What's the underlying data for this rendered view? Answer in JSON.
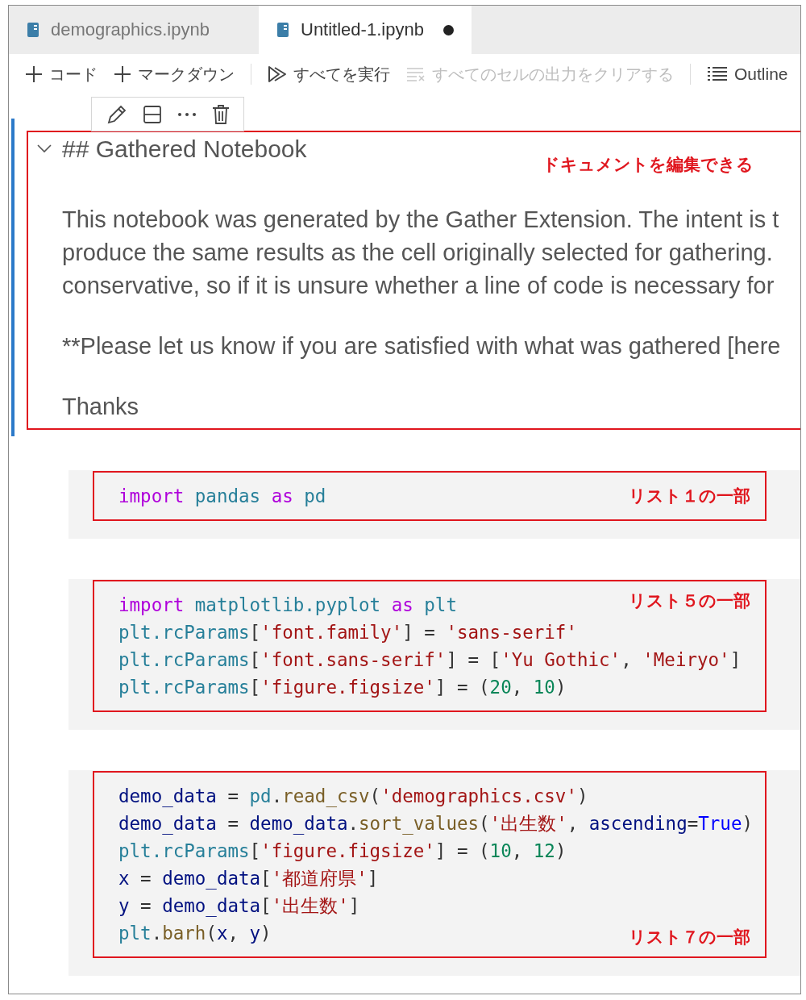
{
  "tabs": [
    {
      "label": "demographics.ipynb",
      "selected": false,
      "modified": false
    },
    {
      "label": "Untitled-1.ipynb",
      "selected": true,
      "modified": true
    }
  ],
  "toolbar": [
    {
      "kind": "add",
      "label": "コード",
      "disabled": false
    },
    {
      "kind": "add",
      "label": "マークダウン",
      "disabled": false
    },
    {
      "kind": "run",
      "label": "すべてを実行",
      "disabled": false
    },
    {
      "kind": "clear",
      "label": "すべてのセルの出力をクリアする",
      "disabled": true
    },
    {
      "kind": "outline",
      "label": "Outline",
      "disabled": false
    }
  ],
  "markdown_cell": {
    "expanded": true,
    "heading": "## Gathered Notebook",
    "annotation": "ドキュメントを編集できる",
    "paragraphs": [
      [
        "This notebook was generated by the Gather Extension. The intent is t",
        "produce the same results as the cell originally selected for gathering.",
        "conservative, so if it is unsure whether a line of code is necessary for"
      ],
      [
        "**Please let us know if you are satisfied with what was gathered [here"
      ],
      [
        "Thanks"
      ]
    ]
  },
  "code_cells": [
    {
      "annotation": "リスト１の一部",
      "lines": [
        [
          {
            "text": "import",
            "kind": "keyword"
          },
          {
            "text": " pandas ",
            "kind": "module"
          },
          {
            "text": "as",
            "kind": "keyword"
          },
          {
            "text": " pd",
            "kind": "module"
          }
        ]
      ]
    },
    {
      "annotation": "リスト５の一部",
      "lines": [
        [
          {
            "text": "import",
            "kind": "keyword"
          },
          {
            "text": " matplotlib.pyplot ",
            "kind": "module"
          },
          {
            "text": "as",
            "kind": "keyword"
          },
          {
            "text": " plt",
            "kind": "module"
          }
        ],
        [
          {
            "text": "plt.rcParams",
            "kind": "module"
          },
          {
            "text": "[",
            "kind": "operator"
          },
          {
            "text": "'font.family'",
            "kind": "string"
          },
          {
            "text": "] = ",
            "kind": "operator"
          },
          {
            "text": "'sans-serif'",
            "kind": "string"
          }
        ],
        [
          {
            "text": "plt.rcParams",
            "kind": "module"
          },
          {
            "text": "[",
            "kind": "operator"
          },
          {
            "text": "'font.sans-serif'",
            "kind": "string"
          },
          {
            "text": "] = [",
            "kind": "operator"
          },
          {
            "text": "'Yu Gothic'",
            "kind": "string"
          },
          {
            "text": ", ",
            "kind": "operator"
          },
          {
            "text": "'Meiryo'",
            "kind": "string"
          },
          {
            "text": "]",
            "kind": "operator"
          }
        ],
        [
          {
            "text": "plt.rcParams",
            "kind": "module"
          },
          {
            "text": "[",
            "kind": "operator"
          },
          {
            "text": "'figure.figsize'",
            "kind": "string"
          },
          {
            "text": "] = (",
            "kind": "operator"
          },
          {
            "text": "20",
            "kind": "number"
          },
          {
            "text": ", ",
            "kind": "operator"
          },
          {
            "text": "10",
            "kind": "number"
          },
          {
            "text": ")",
            "kind": "operator"
          }
        ]
      ]
    },
    {
      "annotation": "リスト７の一部",
      "lines": [
        [
          {
            "text": "demo_data",
            "kind": "variable"
          },
          {
            "text": " = ",
            "kind": "operator"
          },
          {
            "text": "pd",
            "kind": "module"
          },
          {
            "text": ".",
            "kind": "operator"
          },
          {
            "text": "read_csv",
            "kind": "function"
          },
          {
            "text": "(",
            "kind": "operator"
          },
          {
            "text": "'demographics.csv'",
            "kind": "string"
          },
          {
            "text": ")",
            "kind": "operator"
          }
        ],
        [
          {
            "text": "demo_data",
            "kind": "variable"
          },
          {
            "text": " = ",
            "kind": "operator"
          },
          {
            "text": "demo_data",
            "kind": "variable"
          },
          {
            "text": ".",
            "kind": "operator"
          },
          {
            "text": "sort_values",
            "kind": "function"
          },
          {
            "text": "(",
            "kind": "operator"
          },
          {
            "text": "'出生数'",
            "kind": "string"
          },
          {
            "text": ", ",
            "kind": "operator"
          },
          {
            "text": "ascending",
            "kind": "variable"
          },
          {
            "text": "=",
            "kind": "operator"
          },
          {
            "text": "True",
            "kind": "constant"
          },
          {
            "text": ")",
            "kind": "operator"
          }
        ],
        [
          {
            "text": "plt.rcParams",
            "kind": "module"
          },
          {
            "text": "[",
            "kind": "operator"
          },
          {
            "text": "'figure.figsize'",
            "kind": "string"
          },
          {
            "text": "] = (",
            "kind": "operator"
          },
          {
            "text": "10",
            "kind": "number"
          },
          {
            "text": ", ",
            "kind": "operator"
          },
          {
            "text": "12",
            "kind": "number"
          },
          {
            "text": ")",
            "kind": "operator"
          }
        ],
        [
          {
            "text": "x",
            "kind": "variable"
          },
          {
            "text": " = ",
            "kind": "operator"
          },
          {
            "text": "demo_data",
            "kind": "variable"
          },
          {
            "text": "[",
            "kind": "operator"
          },
          {
            "text": "'都道府県'",
            "kind": "string"
          },
          {
            "text": "]",
            "kind": "operator"
          }
        ],
        [
          {
            "text": "y",
            "kind": "variable"
          },
          {
            "text": " = ",
            "kind": "operator"
          },
          {
            "text": "demo_data",
            "kind": "variable"
          },
          {
            "text": "[",
            "kind": "operator"
          },
          {
            "text": "'出生数'",
            "kind": "string"
          },
          {
            "text": "]",
            "kind": "operator"
          }
        ],
        [
          {
            "text": "plt",
            "kind": "module"
          },
          {
            "text": ".",
            "kind": "operator"
          },
          {
            "text": "barh",
            "kind": "function"
          },
          {
            "text": "(",
            "kind": "operator"
          },
          {
            "text": "x",
            "kind": "variable"
          },
          {
            "text": ", ",
            "kind": "operator"
          },
          {
            "text": "y",
            "kind": "variable"
          },
          {
            "text": ")",
            "kind": "operator"
          }
        ]
      ]
    }
  ]
}
